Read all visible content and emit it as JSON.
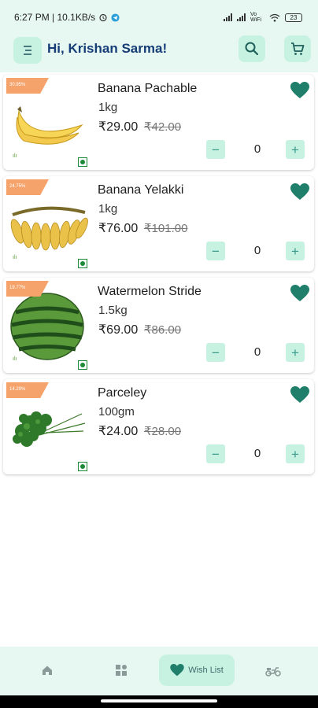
{
  "status_bar": {
    "time_speed": "6:27 PM | 10.1KB/s",
    "battery": "23",
    "wifi_label": "Vo WiFi"
  },
  "header": {
    "greeting": "Hi, Krishan Sarma!"
  },
  "products": [
    {
      "discount": "30.95%",
      "name": "Banana Pachable",
      "qty": "1kg",
      "price": "₹29.00",
      "mrp": "₹42.00",
      "count": "0",
      "image": "bananas"
    },
    {
      "discount": "24.75%",
      "name": "Banana Yelakki",
      "qty": "1kg",
      "price": "₹76.00",
      "mrp": "₹101.00",
      "count": "0",
      "image": "small-bananas"
    },
    {
      "discount": "19.77%",
      "name": "Watermelon Stride",
      "qty": "1.5kg",
      "price": "₹69.00",
      "mrp": "₹86.00",
      "count": "0",
      "image": "watermelon"
    },
    {
      "discount": "14.29%",
      "name": "Parceley",
      "qty": "100gm",
      "price": "₹24.00",
      "mrp": "₹28.00",
      "count": "0",
      "image": "parsley"
    }
  ],
  "stepper": {
    "minus": "−",
    "plus": "+"
  },
  "bottom_nav": {
    "wish_label": "Wish List"
  },
  "colors": {
    "header_bg": "#e6f8f1",
    "button_bg": "#c7f2e1",
    "heart": "#1f7f6b",
    "greeting": "#163d77",
    "discount_tag": "#f5a36b"
  }
}
